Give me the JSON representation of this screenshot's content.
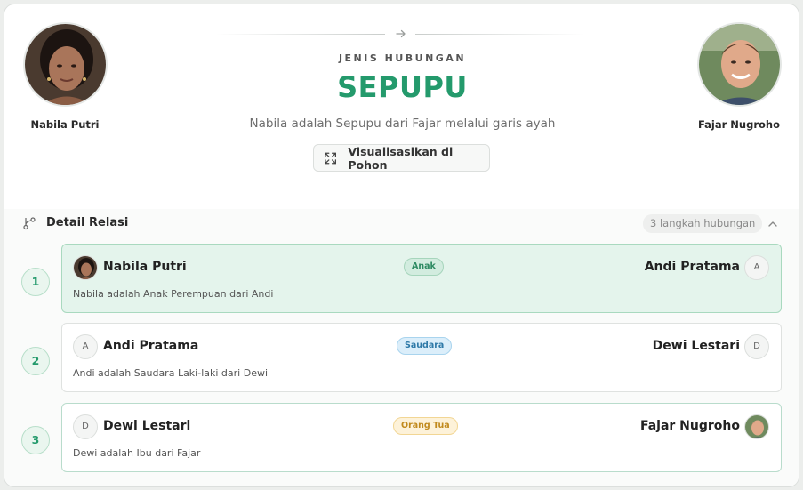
{
  "header": {
    "person_a": {
      "name": "Nabila Putri",
      "avatar": "photo-woman"
    },
    "person_b": {
      "name": "Fajar Nugroho",
      "avatar": "photo-man"
    },
    "relation_label": "JENIS HUBUNGAN",
    "relation_value": "SEPUPU",
    "relation_description": "Nabila adalah Sepupu dari Fajar melalui garis ayah",
    "visualize_button": "Visualisasikan di Pohon",
    "accent_color": "#249a6c"
  },
  "details": {
    "title": "Detail Relasi",
    "steps_count": "3 langkah hubungan",
    "steps": [
      {
        "number": "1",
        "from": "Nabila Putri",
        "from_initial": "",
        "relation": "Anak",
        "to": "Andi Pratama",
        "to_initial": "A",
        "sentence": "Nabila adalah Anak Perempuan dari Andi"
      },
      {
        "number": "2",
        "from": "Andi Pratama",
        "from_initial": "A",
        "relation": "Saudara",
        "to": "Dewi Lestari",
        "to_initial": "D",
        "sentence": "Andi adalah Saudara Laki-laki dari Dewi"
      },
      {
        "number": "3",
        "from": "Dewi Lestari",
        "from_initial": "D",
        "relation": "Orang Tua",
        "to": "Fajar Nugroho",
        "to_initial": "",
        "sentence": "Dewi adalah Ibu dari Fajar"
      }
    ]
  }
}
